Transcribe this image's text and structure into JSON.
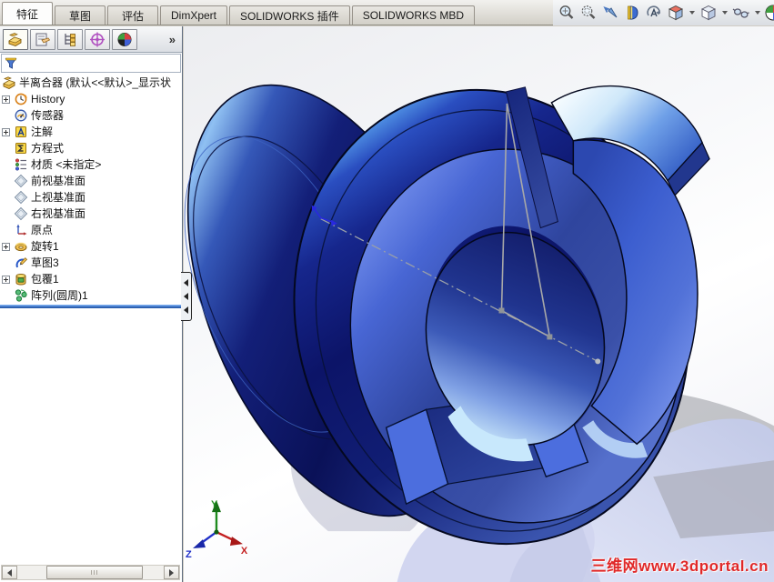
{
  "tab_bar": {
    "tabs": [
      {
        "label": "特征",
        "active": true
      },
      {
        "label": "草图",
        "active": false
      },
      {
        "label": "评估",
        "active": false
      },
      {
        "label": "DimXpert",
        "active": false
      },
      {
        "label": "SOLIDWORKS 插件",
        "active": false
      },
      {
        "label": "SOLIDWORKS MBD",
        "active": false
      }
    ]
  },
  "headsup": {
    "caret_glyph": "",
    "icons": [
      "zoom-to-fit",
      "zoom-to-area",
      "previous-view",
      "section-view",
      "rotate-view",
      "view-orientation",
      "display-style",
      "hide-show-items",
      "edit-appearance"
    ]
  },
  "manager": {
    "expand_glyph": "»",
    "tabs": [
      "featuremanager",
      "propertymanager",
      "configurationmanager",
      "dimxpertmanager",
      "displaymanager"
    ]
  },
  "tree": {
    "items": [
      {
        "label": "半离合器 (默认<<默认>_显示状",
        "icon": "part",
        "expandable": false
      },
      {
        "label": "History",
        "icon": "history",
        "expandable": true
      },
      {
        "label": "传感器",
        "icon": "sensors",
        "expandable": false
      },
      {
        "label": "注解",
        "icon": "annotations",
        "expandable": true
      },
      {
        "label": "方程式",
        "icon": "equations",
        "expandable": false
      },
      {
        "label": "材质 <未指定>",
        "icon": "material",
        "expandable": false
      },
      {
        "label": "前视基准面",
        "icon": "plane",
        "expandable": false
      },
      {
        "label": "上视基准面",
        "icon": "plane",
        "expandable": false
      },
      {
        "label": "右视基准面",
        "icon": "plane",
        "expandable": false
      },
      {
        "label": "原点",
        "icon": "origin",
        "expandable": false
      },
      {
        "label": "旋转1",
        "icon": "revolve",
        "expandable": true
      },
      {
        "label": "草图3",
        "icon": "sketch",
        "expandable": false
      },
      {
        "label": "包覆1",
        "icon": "wrap",
        "expandable": true
      },
      {
        "label": "阵列(圆周)1",
        "icon": "circular-pattern",
        "expandable": false
      }
    ]
  },
  "viewport": {
    "watermark": "三维网www.3dportal.cn",
    "triad": {
      "x": "X",
      "y": "Y",
      "z": "Z"
    }
  },
  "colors": {
    "model_blue": "#3c5ecf",
    "model_dark_navy": "#0d1768",
    "highlight_cyan": "#a8e2f8",
    "reflection_lavender": "#ccd2ee",
    "rollback_blue": "#2e66b8",
    "watermark_red": "#e02828"
  }
}
